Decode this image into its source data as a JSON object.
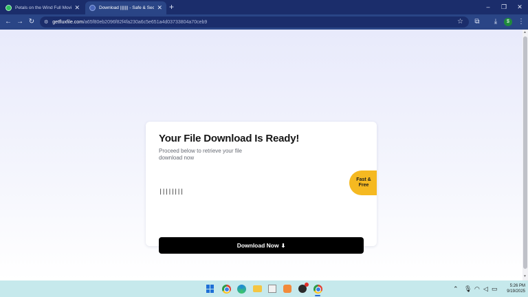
{
  "browser": {
    "tabs": [
      {
        "title": "Petals on the Wind Full Movie",
        "active": false
      },
      {
        "title": "Download ||||||| - Safe & Secure",
        "active": true
      }
    ],
    "new_tab_icon": "+",
    "window_controls": {
      "minimize": "–",
      "maximize": "❐",
      "close": "✕"
    },
    "url_host": "getfluxfile.com",
    "url_path": "/a65f80eb2096f82f4fa230a6c5e651a4d03733804a70ceb9",
    "profile_initial": "$"
  },
  "page": {
    "title": "Your File Download Is Ready!",
    "subtitle": "Proceed below to retrieve your file download now",
    "file_name": "||||||||",
    "badge_line1": "Fast &",
    "badge_line2": "Free",
    "download_label": "Download Now",
    "download_icon": "download-icon",
    "badge_color": "#f5b921",
    "button_color": "#000000"
  },
  "taskbar": {
    "apps": [
      "start",
      "chrome",
      "edge",
      "file-explorer",
      "notepad",
      "media-player",
      "obs",
      "chrome"
    ],
    "time": "5:26 PM",
    "date": "9/19/2025"
  }
}
